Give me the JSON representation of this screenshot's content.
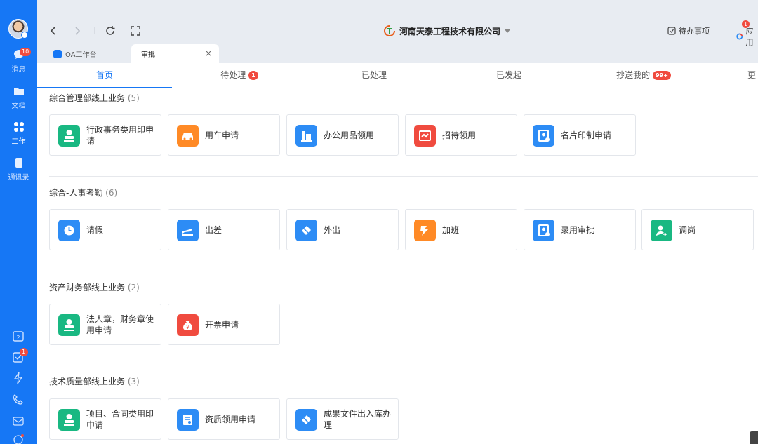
{
  "rail": {
    "items": [
      {
        "label": "消息",
        "badge": "10"
      },
      {
        "label": "文档"
      },
      {
        "label": "工作"
      },
      {
        "label": "通讯录"
      }
    ],
    "tools_badge": "1"
  },
  "topbar": {
    "company": "河南天泰工程技术有限公司",
    "todo_label": "待办事项",
    "todo_badge": "1",
    "apps_label": "应用"
  },
  "window_tabs": [
    {
      "label": "OA工作台"
    },
    {
      "label": "审批",
      "close": "×"
    }
  ],
  "subtabs": [
    {
      "label": "首页"
    },
    {
      "label": "待处理",
      "badge": "1"
    },
    {
      "label": "已处理"
    },
    {
      "label": "已发起"
    },
    {
      "label": "抄送我的",
      "badge": "99+"
    },
    {
      "label": "更"
    }
  ],
  "sections": [
    {
      "title": "综合管理部线上业务",
      "count": "(5)",
      "items": [
        {
          "label": "行政事务类用印申请",
          "icon": "stamp-icon",
          "color": "#19b882"
        },
        {
          "label": "用车申请",
          "icon": "car-icon",
          "color": "#ff8a26"
        },
        {
          "label": "办公用品领用",
          "icon": "office-supplies-icon",
          "color": "#2d8cf5"
        },
        {
          "label": "招待领用",
          "icon": "reception-icon",
          "color": "#f04b3f"
        },
        {
          "label": "名片印制申请",
          "icon": "business-card-icon",
          "color": "#2d8cf5"
        }
      ]
    },
    {
      "title": "综合-人事考勤",
      "count": "(6)",
      "items": [
        {
          "label": "请假",
          "icon": "clock-icon",
          "color": "#2d8cf5"
        },
        {
          "label": "出差",
          "icon": "plane-icon",
          "color": "#2d8cf5"
        },
        {
          "label": "外出",
          "icon": "outing-icon",
          "color": "#2d8cf5"
        },
        {
          "label": "加班",
          "icon": "overtime-icon",
          "color": "#ff8a26"
        },
        {
          "label": "录用审批",
          "icon": "hire-icon",
          "color": "#2d8cf5"
        },
        {
          "label": "调岗",
          "icon": "transfer-icon",
          "color": "#19b882"
        }
      ]
    },
    {
      "title": "资产财务部线上业务",
      "count": "(2)",
      "items": [
        {
          "label": "法人章，财务章使用申请",
          "icon": "stamp-icon",
          "color": "#19b882"
        },
        {
          "label": "开票申请",
          "icon": "money-bag-icon",
          "color": "#f04b3f"
        }
      ]
    },
    {
      "title": "技术质量部线上业务",
      "count": "(3)",
      "items": [
        {
          "label": "项目、合同类用印申请",
          "icon": "stamp-icon",
          "color": "#19b882"
        },
        {
          "label": "资质领用申请",
          "icon": "certificate-icon",
          "color": "#2d8cf5"
        },
        {
          "label": "成果文件出入库办理",
          "icon": "file-archive-icon",
          "color": "#2d8cf5"
        }
      ]
    }
  ]
}
